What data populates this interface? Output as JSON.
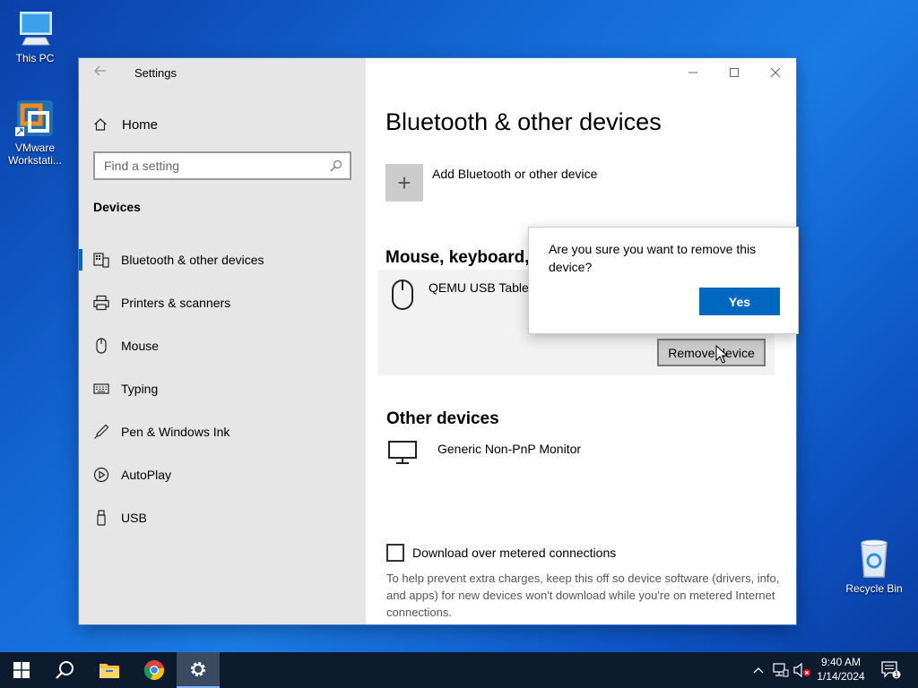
{
  "desktop": {
    "icons": [
      {
        "label": "This PC",
        "icon": "computer-icon"
      },
      {
        "label": "VMware Workstati...",
        "icon": "vmware-icon"
      },
      {
        "label": "Recycle Bin",
        "icon": "recycle-bin-icon"
      }
    ]
  },
  "window": {
    "title": "Settings",
    "sidebar": {
      "home_label": "Home",
      "search_placeholder": "Find a setting",
      "section_label": "Devices",
      "items": [
        {
          "label": "Bluetooth & other devices",
          "icon": "bluetooth-devices-icon",
          "active": true
        },
        {
          "label": "Printers & scanners",
          "icon": "printer-icon",
          "active": false
        },
        {
          "label": "Mouse",
          "icon": "mouse-icon",
          "active": false
        },
        {
          "label": "Typing",
          "icon": "keyboard-icon",
          "active": false
        },
        {
          "label": "Pen & Windows Ink",
          "icon": "pen-icon",
          "active": false
        },
        {
          "label": "AutoPlay",
          "icon": "autoplay-icon",
          "active": false
        },
        {
          "label": "USB",
          "icon": "usb-icon",
          "active": false
        }
      ]
    },
    "main": {
      "page_title": "Bluetooth & other devices",
      "add_device_label": "Add Bluetooth or other device",
      "mouse_section_title": "Mouse, keyboard, & pen",
      "mouse_device_name": "QEMU USB Tablet",
      "remove_button_label": "Remove device",
      "other_section_title": "Other devices",
      "other_device_name": "Generic Non-PnP Monitor",
      "metered_label": "Download over metered connections",
      "metered_checked": false,
      "metered_description": "To help prevent extra charges, keep this off so device software (drivers, info, and apps) for new devices won't download while you're on metered Internet connections."
    },
    "confirm_flyout": {
      "question": "Are you sure you want to remove this device?",
      "yes_label": "Yes"
    }
  },
  "taskbar": {
    "time": "9:40 AM",
    "date": "1/14/2024",
    "notification_count": "1",
    "apps": [
      "start-icon",
      "search-icon",
      "file-explorer-icon",
      "chrome-icon",
      "settings-icon"
    ]
  },
  "colors": {
    "accent": "#0067c0",
    "sidebar_bg": "#e6e6e6",
    "taskbar_bg": "#0d1b2e"
  }
}
